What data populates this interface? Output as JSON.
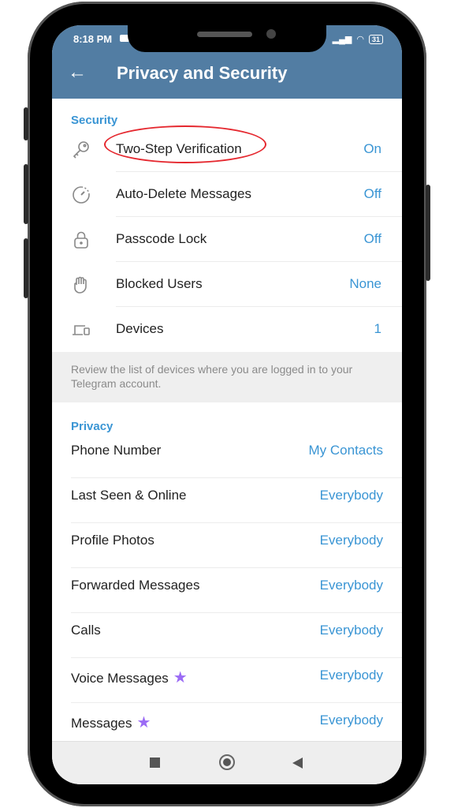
{
  "status_bar": {
    "time": "8:18 PM",
    "battery": "31"
  },
  "app_bar": {
    "back_icon": "arrow-left-icon",
    "title": "Privacy and Security"
  },
  "security": {
    "header": "Security",
    "items": [
      {
        "icon": "key-icon",
        "label": "Two-Step Verification",
        "value": "On",
        "highlighted": true
      },
      {
        "icon": "timer-icon",
        "label": "Auto-Delete Messages",
        "value": "Off"
      },
      {
        "icon": "lock-icon",
        "label": "Passcode Lock",
        "value": "Off"
      },
      {
        "icon": "hand-icon",
        "label": "Blocked Users",
        "value": "None"
      },
      {
        "icon": "devices-icon",
        "label": "Devices",
        "value": "1"
      }
    ],
    "info": "Review the list of devices where you are logged in to your Telegram account."
  },
  "privacy": {
    "header": "Privacy",
    "items": [
      {
        "label": "Phone Number",
        "value": "My Contacts"
      },
      {
        "label": "Last Seen & Online",
        "value": "Everybody"
      },
      {
        "label": "Profile Photos",
        "value": "Everybody"
      },
      {
        "label": "Forwarded Messages",
        "value": "Everybody"
      },
      {
        "label": "Calls",
        "value": "Everybody"
      },
      {
        "label": "Voice Messages",
        "value": "Everybody",
        "premium": true
      },
      {
        "label": "Messages",
        "value": "Everybody",
        "premium": true
      }
    ]
  },
  "nav_bar": {
    "recents": "recents-button",
    "home": "home-button",
    "back": "back-button"
  },
  "colors": {
    "accent": "#3a95d4",
    "app_bar": "#527da3",
    "highlight_oval": "#e5282f",
    "premium_star": "#9b6bf5"
  }
}
